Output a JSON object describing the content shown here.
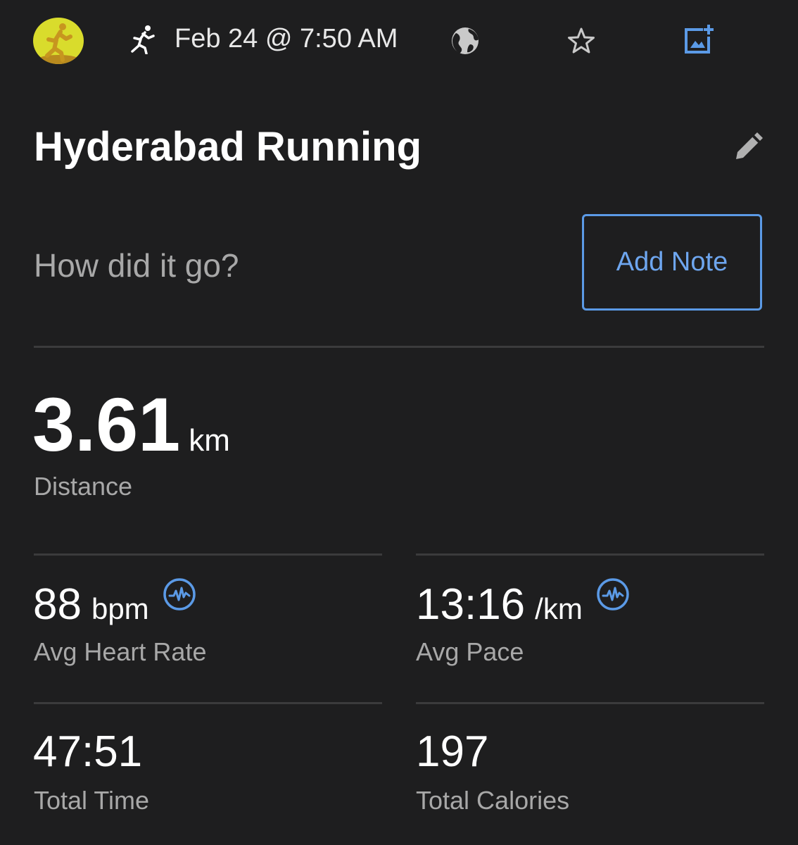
{
  "header": {
    "datetime": "Feb 24 @ 7:50 AM",
    "icons": [
      "running-avatar-icon",
      "running-icon",
      "globe-icon",
      "star-icon",
      "add-photo-icon"
    ]
  },
  "activity": {
    "title": "Hyderabad Running",
    "prompt": "How did it go?",
    "add_note_label": "Add Note"
  },
  "stats": {
    "distance": {
      "value": "3.61",
      "unit": "km",
      "label": "Distance"
    },
    "heart_rate": {
      "value": "88",
      "unit": "bpm",
      "label": "Avg Heart Rate"
    },
    "pace": {
      "value": "13:16",
      "unit": "/km",
      "label": "Avg Pace"
    },
    "time": {
      "value": "47:51",
      "label": "Total Time"
    },
    "calories": {
      "value": "197",
      "label": "Total Calories"
    }
  },
  "colors": {
    "background": "#1e1e1f",
    "accent": "#5b9ae6",
    "avatar": "#d9dc2c"
  }
}
